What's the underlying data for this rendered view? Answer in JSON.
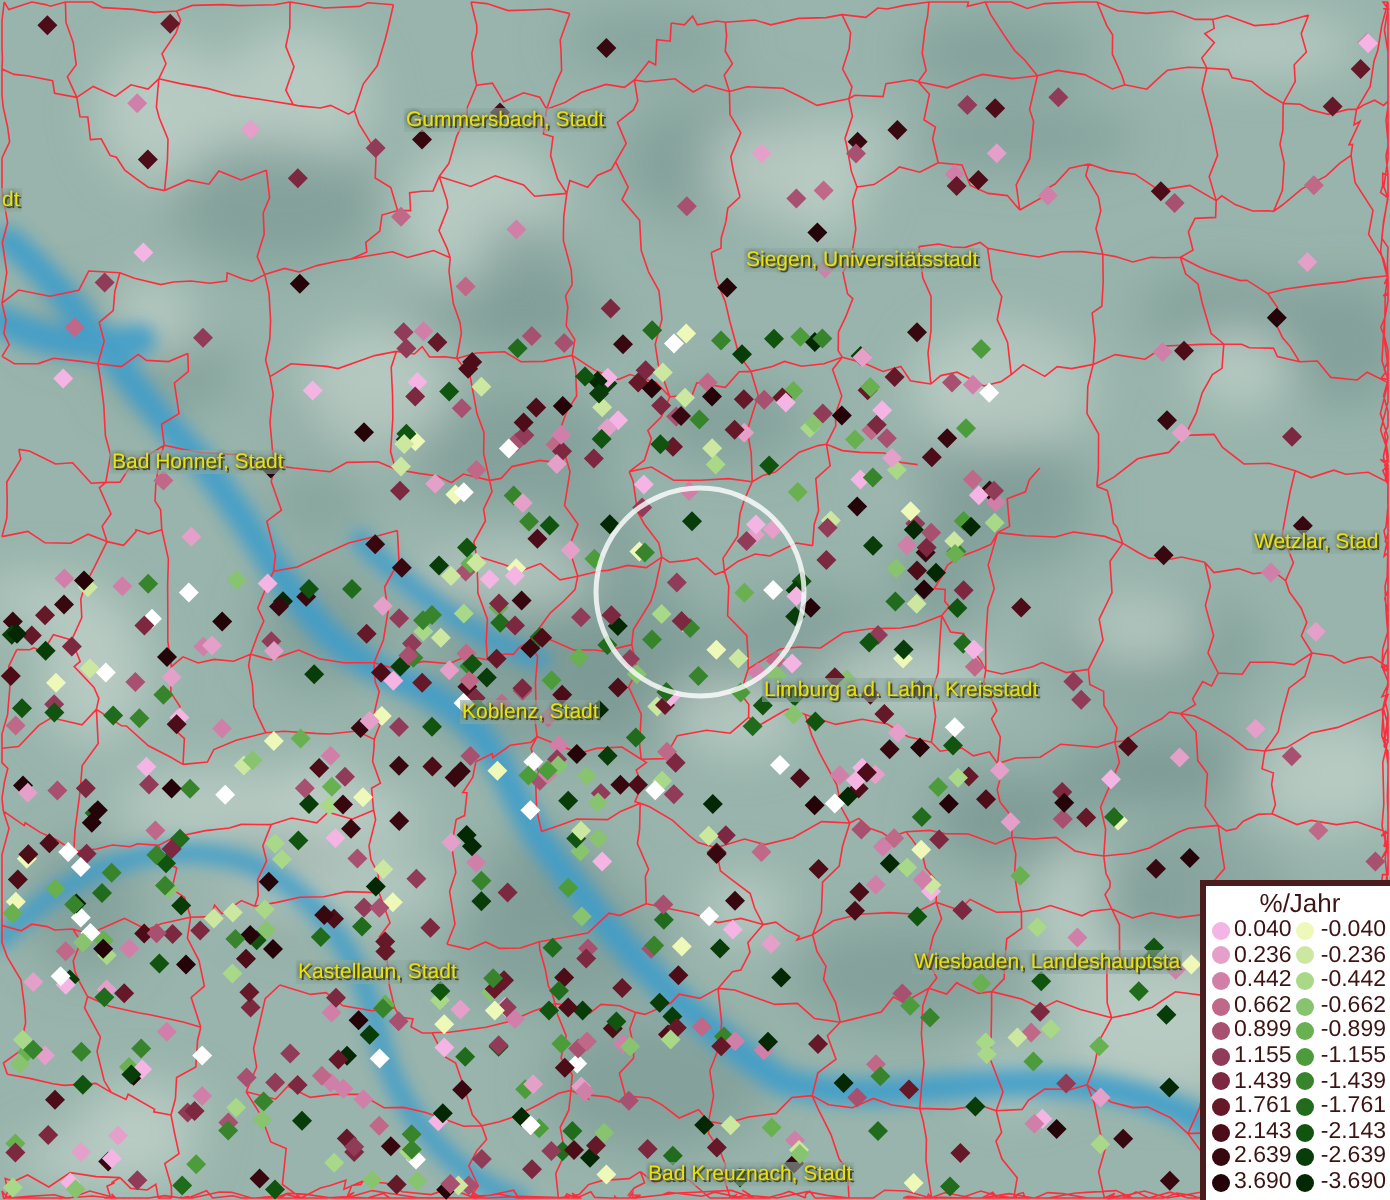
{
  "map": {
    "labels": [
      {
        "text": "dt"
      },
      {
        "text": "Gummersbach, Stadt"
      },
      {
        "text": "Siegen, Universitätsstadt"
      },
      {
        "text": "Bad Honnef, Stadt"
      },
      {
        "text": "Wetzlar, Stad"
      },
      {
        "text": "Koblenz, Stadt"
      },
      {
        "text": "Limburg a.d. Lahn, Kreisstadt"
      },
      {
        "text": "Kastellaun, Stadt"
      },
      {
        "text": "Wiesbaden, Landeshauptsta"
      },
      {
        "text": "Bad Kreuznach, Stadt"
      }
    ]
  },
  "legend": {
    "title": "%/Jahr",
    "positive": [
      {
        "value": "0.040",
        "color": "#f4b4e4"
      },
      {
        "value": "0.236",
        "color": "#e4a0c8"
      },
      {
        "value": "0.442",
        "color": "#d080a8"
      },
      {
        "value": "0.662",
        "color": "#c06888"
      },
      {
        "value": "0.899",
        "color": "#a85070"
      },
      {
        "value": "1.155",
        "color": "#903c58"
      },
      {
        "value": "1.439",
        "color": "#7c2840"
      },
      {
        "value": "1.761",
        "color": "#641828"
      },
      {
        "value": "2.143",
        "color": "#4c0c18"
      },
      {
        "value": "2.639",
        "color": "#380810"
      },
      {
        "value": "3.690",
        "color": "#240408"
      }
    ],
    "negative": [
      {
        "value": "-0.040",
        "color": "#eef8b8"
      },
      {
        "value": "-0.236",
        "color": "#cce8a0"
      },
      {
        "value": "-0.442",
        "color": "#a8d888"
      },
      {
        "value": "-0.662",
        "color": "#88c470"
      },
      {
        "value": "-0.899",
        "color": "#68b050"
      },
      {
        "value": "-1.155",
        "color": "#4c9c3c"
      },
      {
        "value": "-1.439",
        "color": "#38842c"
      },
      {
        "value": "-1.761",
        "color": "#206c1c"
      },
      {
        "value": "-2.143",
        "color": "#105410"
      },
      {
        "value": "-2.639",
        "color": "#083c08"
      },
      {
        "value": "-3.690",
        "color": "#042804"
      }
    ]
  }
}
